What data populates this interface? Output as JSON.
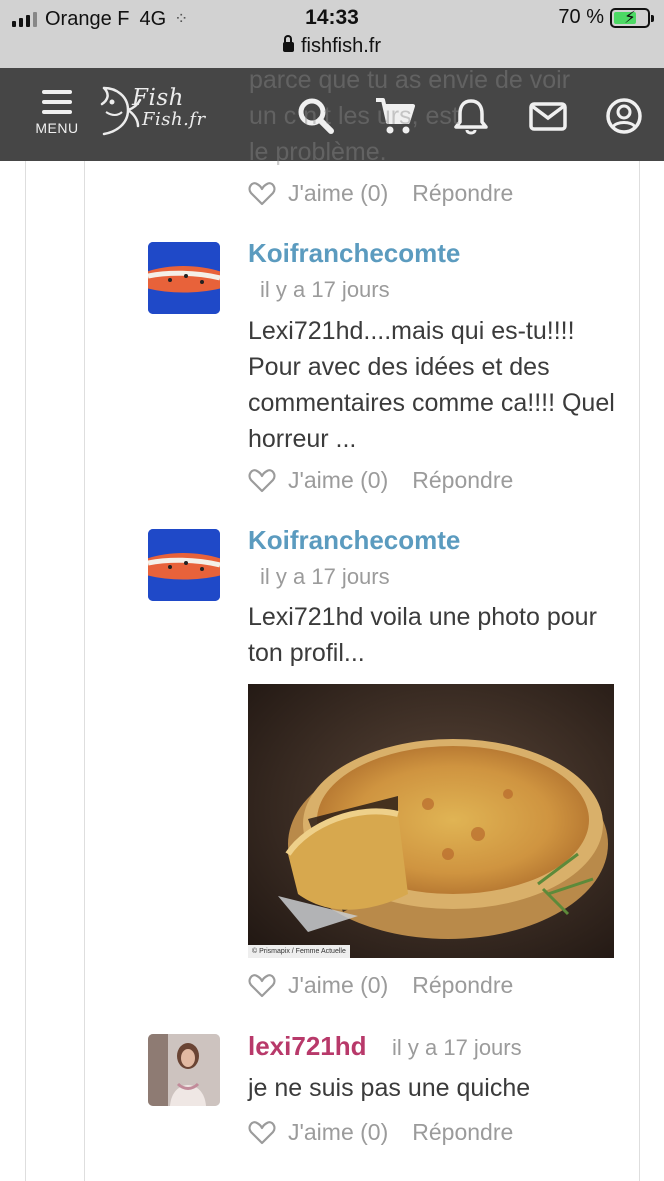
{
  "status_bar": {
    "carrier": "Orange F",
    "network": "4G",
    "time": "14:33",
    "battery": "70 %",
    "battery_level": 0.7
  },
  "url": "fishfish.fr",
  "nav": {
    "menu_label": "MENU",
    "logo_line1": "Fish",
    "logo_line2": "Fish.fr",
    "icons": [
      "search-icon",
      "cart-icon",
      "bell-icon",
      "mail-icon",
      "account-icon"
    ],
    "bg_color": "#2b2b2b"
  },
  "ghost_text": "parce que tu as envie de voir\nun c     n t     les   urs,   est\nle problème.",
  "actions": {
    "like": "J'aime (0)",
    "reply": "Répondre"
  },
  "comments": [
    {
      "author": "Koifranchecomte",
      "time": "il y a 17 jours",
      "text": "Lexi721hd....mais qui es-tu!!!! Pour avec des idées et des commentaires comme ca!!!! Quel horreur ..."
    },
    {
      "author": "Koifranchecomte",
      "time": "il y a 17 jours",
      "text": "Lexi721hd voila une photo pour ton profil...",
      "image_credit": "© Prismapix / Femme Actuelle"
    },
    {
      "author": "lexi721hd",
      "time": "il y a 17 jours",
      "text": "je ne suis pas une quiche"
    }
  ],
  "colors": {
    "author_blue": "#5b9bbf",
    "author_pink": "#b8396a",
    "meta_gray": "#9b9b9b"
  }
}
